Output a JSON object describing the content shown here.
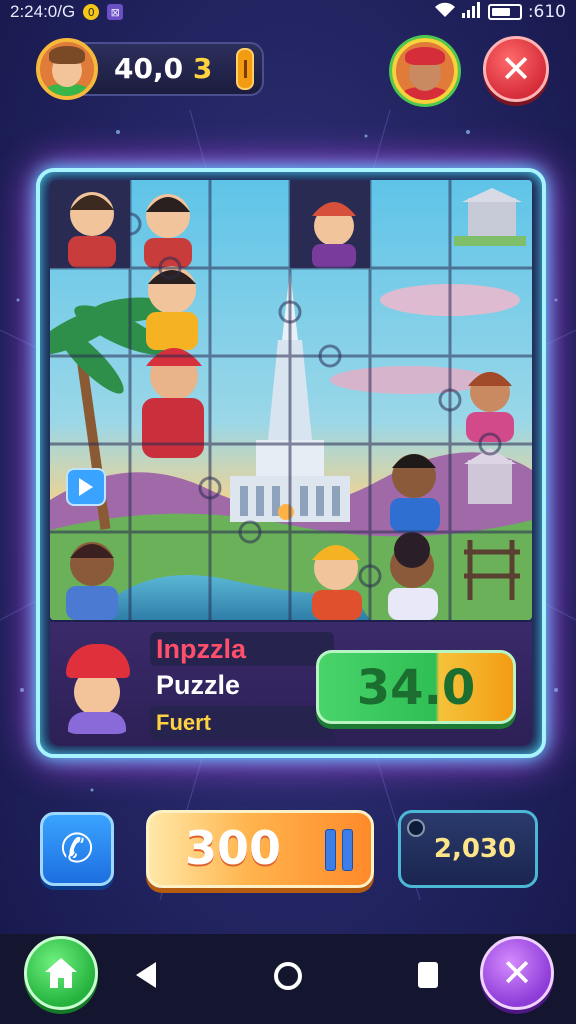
{
  "status_bar": {
    "time": "2:24:0/G",
    "right_text": ":610"
  },
  "hud": {
    "score": "40,0",
    "level": "3",
    "close_label": "✕"
  },
  "info_panel": {
    "line1": "Inpzzla",
    "line2": "Puzzle",
    "line3": "Fuert",
    "score": "34.0"
  },
  "bottom": {
    "timer_value": "300",
    "coins": "2,030"
  },
  "nav": {
    "close_label": "✕"
  },
  "colors": {
    "frame_glow": "#4de3ff",
    "accent_pink": "#d44cff",
    "close_red": "#d62d3a",
    "home_green": "#25b33e",
    "purple_button": "#8e3cd8"
  },
  "icons": [
    "signal-icon",
    "wifi-icon",
    "battery-icon",
    "close-icon",
    "phone-icon",
    "pause-icon",
    "home-icon",
    "back-icon",
    "recent-apps-icon",
    "play-icon"
  ]
}
